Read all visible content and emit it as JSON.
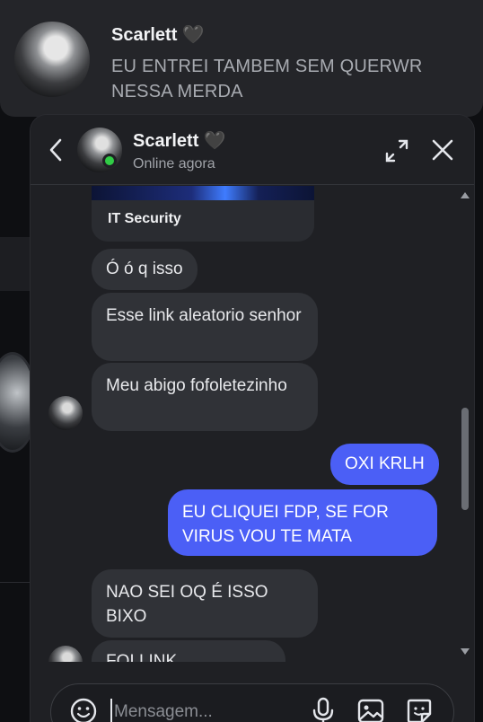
{
  "toast": {
    "name": "Scarlett 🖤",
    "text": "EU ENTREI TAMBEM SEM QUERWR NESSA MERDA"
  },
  "chat": {
    "contact_name": "Scarlett 🖤",
    "status": "Online agora",
    "preview_card_title": "IT Security",
    "messages": [
      {
        "from": "them",
        "text": "Ó ó q isso"
      },
      {
        "from": "them",
        "text": "Esse link aleatorio senhor"
      },
      {
        "from": "them",
        "text": "Meu abigo fofoletezinho"
      },
      {
        "from": "me",
        "text": "OXI KRLH"
      },
      {
        "from": "me",
        "text": "EU CLIQUEI FDP, SE FOR VIRUS VOU TE MATA"
      },
      {
        "from": "them",
        "text": "NAO SEI OQ É ISSO BIXO"
      },
      {
        "from": "them",
        "text": "FOI LINK ALEATRRIO"
      }
    ],
    "composer_placeholder": "Mensagem..."
  },
  "icons": {
    "back": "chevron-left-icon",
    "expand": "expand-icon",
    "close": "close-icon",
    "emoji": "emoji-icon",
    "mic": "microphone-icon",
    "image": "image-icon",
    "sticker": "sticker-icon"
  },
  "colors": {
    "accent": "#4b5ff6",
    "online": "#31cc46",
    "bubble_them": "#303237",
    "panel": "#1f2024"
  }
}
